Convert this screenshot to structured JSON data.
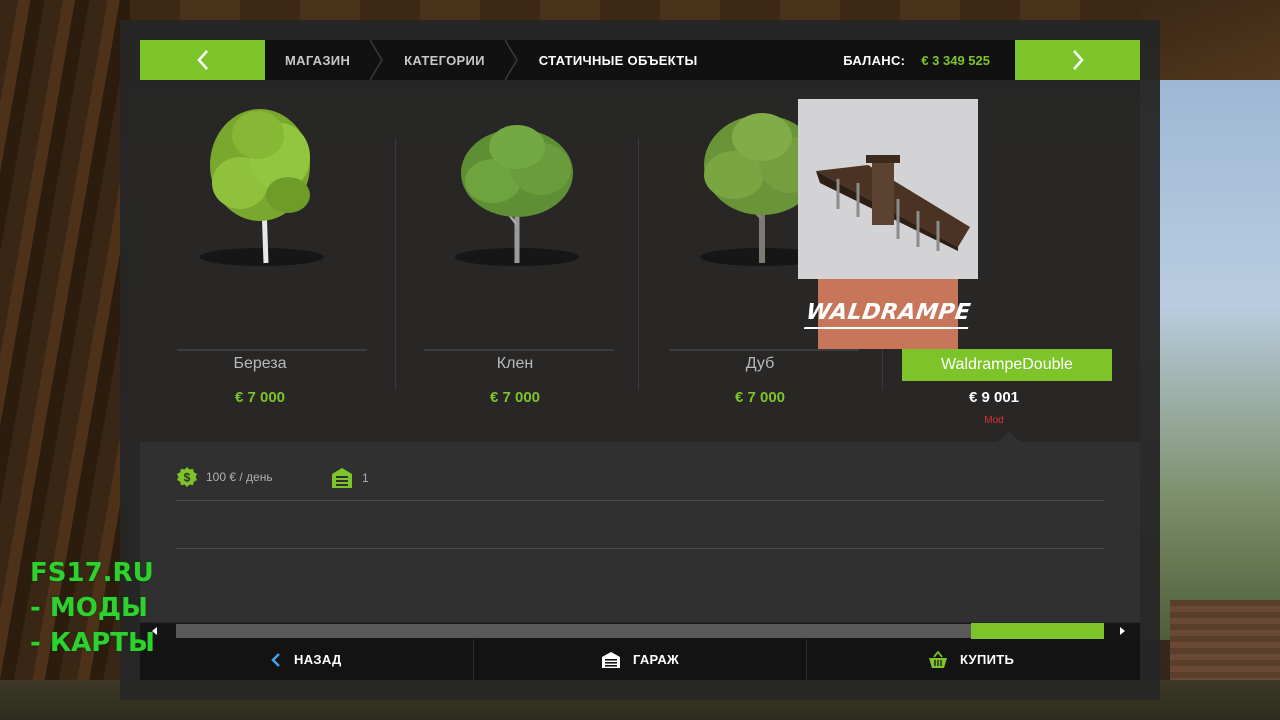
{
  "breadcrumb": {
    "items": [
      "МАГАЗИН",
      "КАТЕГОРИИ",
      "СТАТИЧНЫЕ ОБЪЕКТЫ"
    ]
  },
  "balance": {
    "label": "БАЛАНС:",
    "value": "€ 3 349 525"
  },
  "items": [
    {
      "name": "Береза",
      "price": "€ 7 000",
      "icon": "birch-tree-icon"
    },
    {
      "name": "Клен",
      "price": "€ 7 000",
      "icon": "maple-tree-icon"
    },
    {
      "name": "Дуб",
      "price": "€ 7 000",
      "icon": "oak-tree-icon"
    },
    {
      "name": "WaldrampeDouble",
      "price": "€ 9 001",
      "tag": "Mod",
      "logo_text": "WALDRAMPE",
      "icon": "ramp-icon",
      "selected": true
    }
  ],
  "details": {
    "upkeep": "100 € / день",
    "count": "1"
  },
  "bottom": {
    "back_label": "НАЗАД",
    "garage_label": "ГАРАЖ",
    "buy_label": "КУПИТЬ"
  },
  "scrollbar": {
    "position_fraction": 0.86
  },
  "watermark": {
    "lines": [
      "FS17.RU",
      "- МОДЫ",
      "- КАРТЫ"
    ]
  },
  "colors": {
    "accent": "#7dc42b",
    "panel": "#262626",
    "mod_tag": "#e03030",
    "watermark": "#2fd12f"
  }
}
